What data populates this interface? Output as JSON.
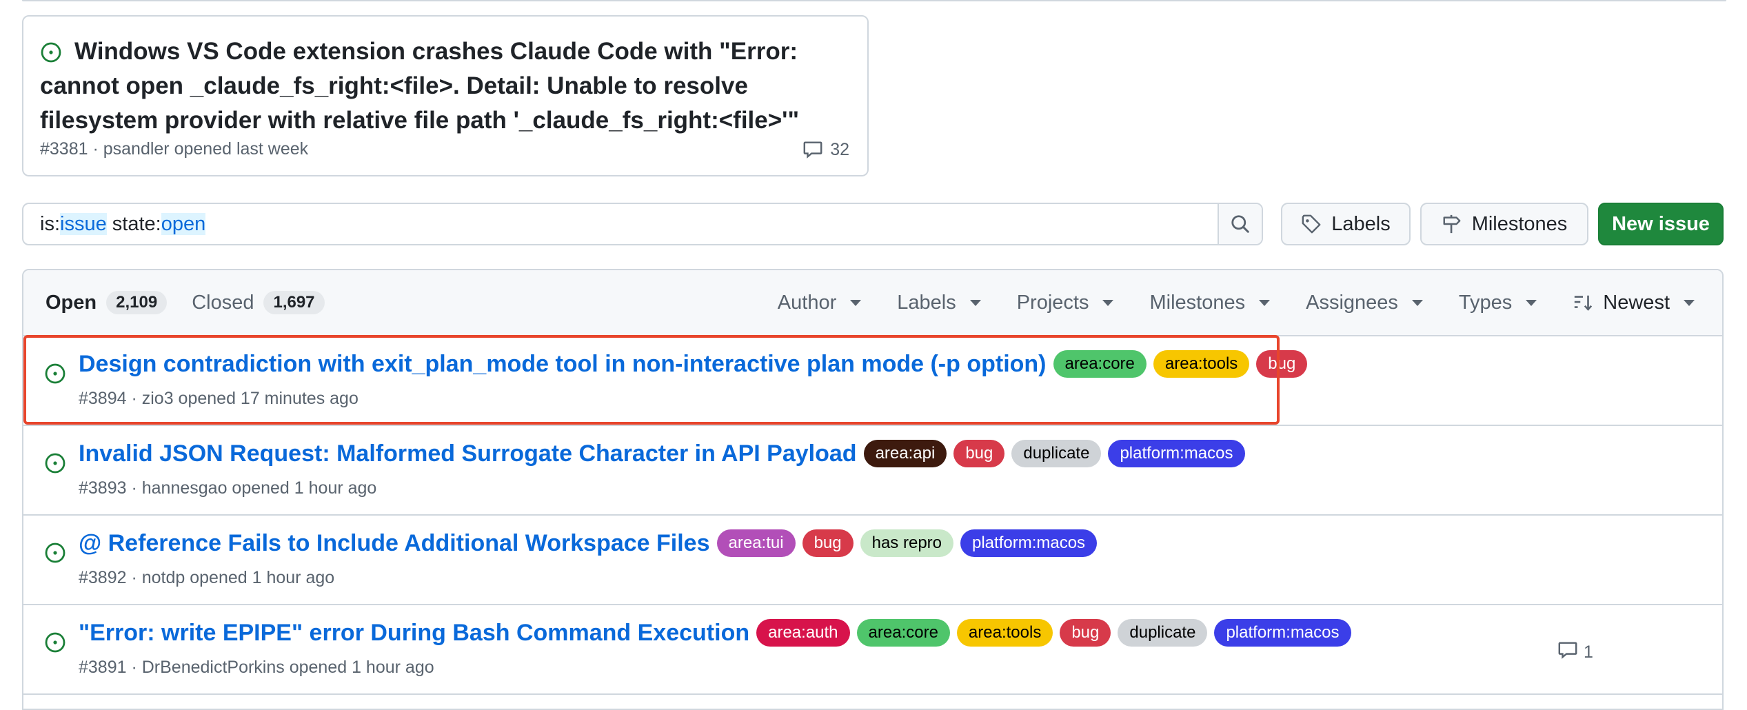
{
  "pinned": {
    "title": "Windows VS Code extension crashes Claude Code with \"Error: cannot open _claude_fs_right:<file>. Detail: Unable to resolve filesystem provider with relative file path '_claude_fs_right:<file>'\"",
    "meta": "#3381 · psandler opened last week",
    "comments": "32"
  },
  "search": {
    "prefix1": "is:",
    "value1": "issue",
    "prefix2": " state:",
    "value2": "open"
  },
  "buttons": {
    "labels": "Labels",
    "milestones": "Milestones",
    "new_issue": "New issue"
  },
  "tabs": {
    "open_label": "Open",
    "open_count": "2,109",
    "closed_label": "Closed",
    "closed_count": "1,697"
  },
  "filters": [
    "Author",
    "Labels",
    "Projects",
    "Milestones",
    "Assignees",
    "Types",
    "Newest"
  ],
  "issues": [
    {
      "title": "Design contradiction with exit_plan_mode tool in non-interactive plan mode (-p option)",
      "meta": "#3894 · zio3 opened 17 minutes ago",
      "labels": [
        {
          "text": "area:core",
          "bg": "#4fc56b",
          "fg": "#000000"
        },
        {
          "text": "area:tools",
          "bg": "#f7c600",
          "fg": "#000000"
        },
        {
          "text": "bug",
          "bg": "#d73a4a",
          "fg": "#ffffff"
        }
      ],
      "comments": ""
    },
    {
      "title": "Invalid JSON Request: Malformed Surrogate Character in API Payload",
      "meta": "#3893 · hannesgao opened 1 hour ago",
      "labels": [
        {
          "text": "area:api",
          "bg": "#3d1a0e",
          "fg": "#ffffff"
        },
        {
          "text": "bug",
          "bg": "#d73a4a",
          "fg": "#ffffff"
        },
        {
          "text": "duplicate",
          "bg": "#cfd3d7",
          "fg": "#000000"
        },
        {
          "text": "platform:macos",
          "bg": "#3b3ee8",
          "fg": "#ffffff"
        }
      ],
      "comments": ""
    },
    {
      "title": "@ Reference Fails to Include Additional Workspace Files",
      "meta": "#3892 · notdp opened 1 hour ago",
      "labels": [
        {
          "text": "area:tui",
          "bg": "#b24fb8",
          "fg": "#ffffff"
        },
        {
          "text": "bug",
          "bg": "#d73a4a",
          "fg": "#ffffff"
        },
        {
          "text": "has repro",
          "bg": "#c9e8c9",
          "fg": "#000000"
        },
        {
          "text": "platform:macos",
          "bg": "#3b3ee8",
          "fg": "#ffffff"
        }
      ],
      "comments": ""
    },
    {
      "title": "\"Error: write EPIPE\" error During Bash Command Execution",
      "meta": "#3891 · DrBenedictPorkins opened 1 hour ago",
      "labels": [
        {
          "text": "area:auth",
          "bg": "#d7134b",
          "fg": "#ffffff"
        },
        {
          "text": "area:core",
          "bg": "#4fc56b",
          "fg": "#000000"
        },
        {
          "text": "area:tools",
          "bg": "#f7c600",
          "fg": "#000000"
        },
        {
          "text": "bug",
          "bg": "#d73a4a",
          "fg": "#ffffff"
        },
        {
          "text": "duplicate",
          "bg": "#cfd3d7",
          "fg": "#000000"
        },
        {
          "text": "platform:macos",
          "bg": "#3b3ee8",
          "fg": "#ffffff"
        }
      ],
      "comments": "1"
    }
  ],
  "colors": {
    "accent": "#0969da",
    "open_icon": "#1a7f37",
    "primary_button": "#1f883d",
    "highlight": "#e8452c"
  },
  "icons": [
    "issue-open-icon",
    "comment-icon",
    "search-icon",
    "tag-icon",
    "milestone-icon",
    "sort-icon",
    "caret-down-icon"
  ]
}
